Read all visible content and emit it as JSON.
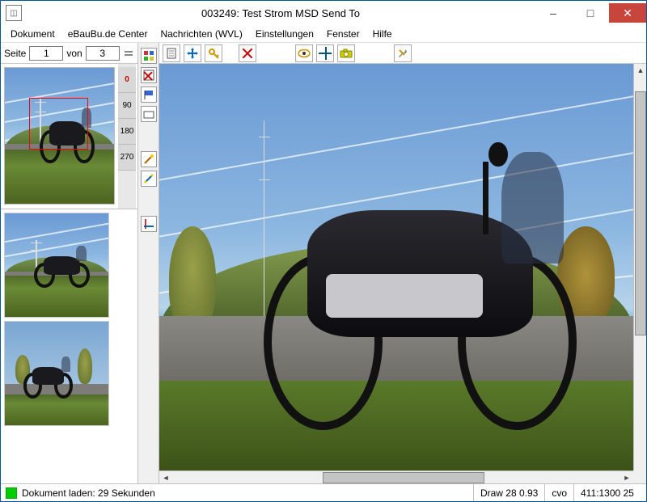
{
  "window": {
    "title": "003249: Test Strom MSD Send To",
    "minimize": "–",
    "maximize": "□",
    "close": "✕"
  },
  "menu": {
    "items": [
      "Dokument",
      "eBauBu.de Center",
      "Nachrichten (WVL)",
      "Einstellungen",
      "Fenster",
      "Hilfe"
    ]
  },
  "page": {
    "label": "Seite",
    "current": "1",
    "of_label": "von",
    "total": "3"
  },
  "rotation": {
    "r0": "0",
    "r90": "90",
    "r180": "180",
    "r270": "270"
  },
  "midtools": [
    {
      "name": "tool-color-palette",
      "glyph": "▦"
    },
    {
      "name": "tool-disable",
      "glyph": "⬚"
    },
    {
      "name": "tool-flag",
      "glyph": "▢"
    },
    {
      "name": "tool-layer",
      "glyph": "▭"
    },
    {
      "name": "tool-wand",
      "glyph": "✎"
    },
    {
      "name": "tool-measure",
      "glyph": "✧"
    },
    {
      "name": "tool-crop",
      "glyph": "✂"
    }
  ],
  "toolbar": [
    {
      "name": "page-icon",
      "type": "page"
    },
    {
      "name": "move-icon",
      "type": "arrows4"
    },
    {
      "name": "key-icon",
      "type": "key"
    },
    {
      "name": "delete-icon",
      "type": "redx"
    },
    {
      "name": "spacer1",
      "type": "sp"
    },
    {
      "name": "eye-icon",
      "type": "eye"
    },
    {
      "name": "crosshair-icon",
      "type": "cross"
    },
    {
      "name": "camera-icon",
      "type": "cam"
    },
    {
      "name": "spacer2",
      "type": "sp"
    },
    {
      "name": "tools-icon",
      "type": "wrench"
    }
  ],
  "status": {
    "load_text": "Dokument laden: 29 Sekunden",
    "draw": "Draw 28 0.93",
    "user": "cvo",
    "coords": "411:1300 25"
  }
}
